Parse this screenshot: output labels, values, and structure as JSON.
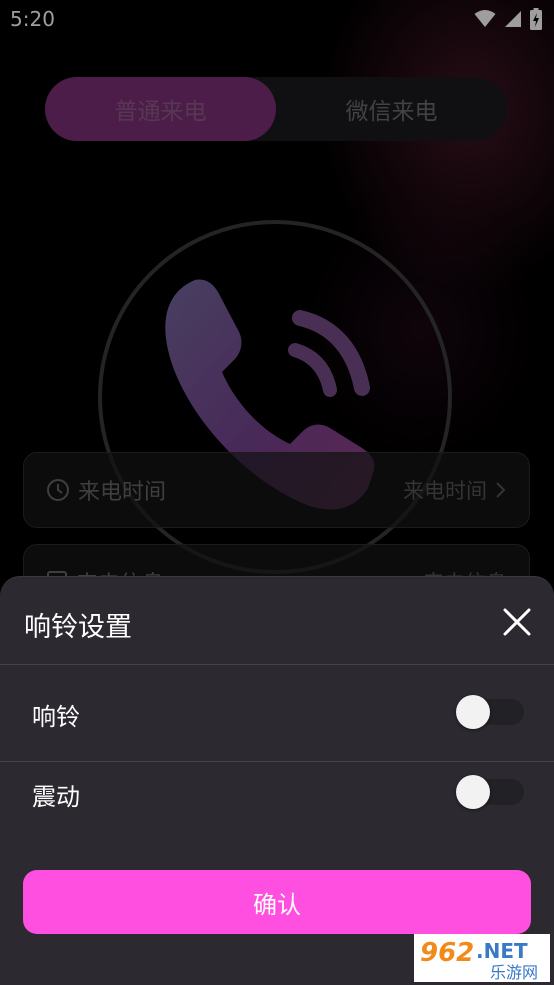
{
  "status_bar": {
    "time": "5:20"
  },
  "tabs": [
    {
      "label": "普通来电",
      "active": true
    },
    {
      "label": "微信来电",
      "active": false
    }
  ],
  "rows": [
    {
      "label": "来电时间",
      "value": "来电时间",
      "icon": "clock-icon"
    },
    {
      "label": "来电信息",
      "value": "来电信息",
      "icon": "document-icon"
    }
  ],
  "sheet": {
    "title": "响铃设置",
    "settings": [
      {
        "label": "响铃",
        "enabled": false
      },
      {
        "label": "震动",
        "enabled": false
      }
    ],
    "confirm_label": "确认"
  },
  "watermark": {
    "number": "962",
    "domain": ".NET",
    "site": "乐游网"
  },
  "colors": {
    "accent": "#ff4fe0",
    "tab_active": "#7d2f78",
    "sheet_bg": "#2c2a30"
  }
}
